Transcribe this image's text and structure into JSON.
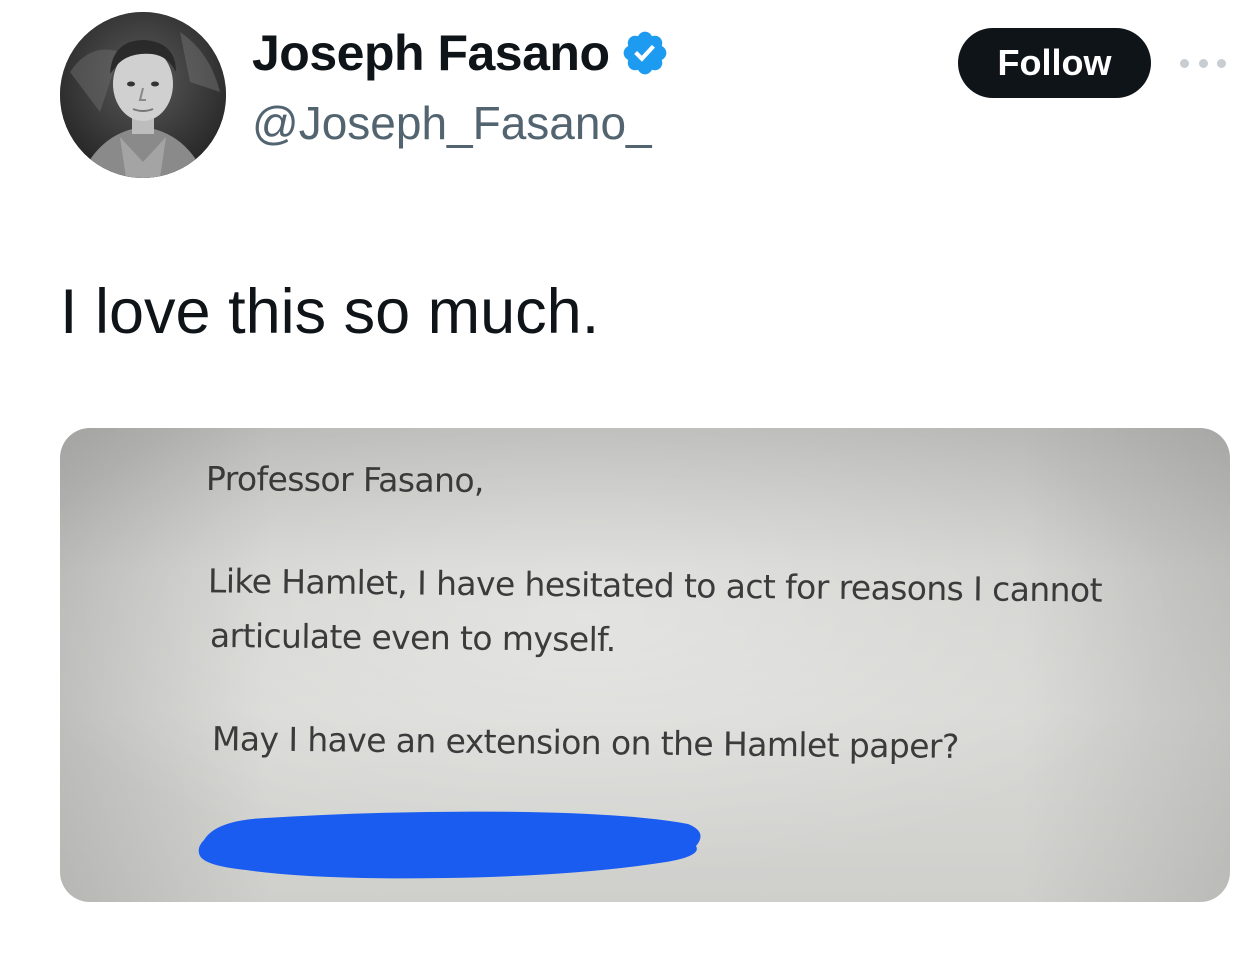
{
  "author": {
    "display_name": "Joseph Fasano",
    "handle": "@Joseph_Fasano_",
    "verified_icon": "verified-badge-icon"
  },
  "actions": {
    "follow_label": "Follow",
    "more_icon": "more-options-icon"
  },
  "tweet": {
    "text": "I love this so much."
  },
  "media": {
    "lines": [
      "Professor Fasano,",
      "Like Hamlet, I have hesitated to act for reasons I cannot",
      "articulate even to myself.",
      "May I have an extension on the Hamlet paper?"
    ]
  },
  "colors": {
    "accent_blue": "#1d9bf0",
    "follow_button_bg": "#0f1419",
    "handle_text": "#536471",
    "redaction_blue": "#1a5bf0"
  }
}
